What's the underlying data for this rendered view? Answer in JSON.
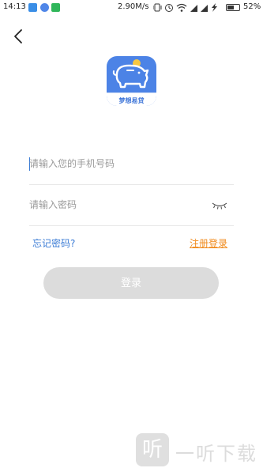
{
  "status_bar": {
    "time": "14:13",
    "network_speed": "2.90M/s",
    "battery": "52%",
    "icons": [
      "usb-icon",
      "app-notification-icon",
      "wechat-icon",
      "vibrate-icon",
      "alarm-icon",
      "wifi-icon",
      "signal-icon",
      "signal-icon",
      "charging-icon",
      "battery-icon"
    ]
  },
  "nav": {
    "back_icon": "back-arrow-icon"
  },
  "app": {
    "name": "梦想易贷",
    "brand_color": "#4c83e6"
  },
  "form": {
    "phone_placeholder": "请输入您的手机号码",
    "password_placeholder": "请输入密码",
    "password_toggle_icon": "eye-closed-icon"
  },
  "links": {
    "forgot_password": "忘记密码?",
    "register": "注册登录"
  },
  "login_button": "登录",
  "watermark": {
    "glyph": "听",
    "text": "一听下载"
  },
  "colors": {
    "link_blue": "#3a7bd5",
    "register_orange": "#f08a1c",
    "button_disabled": "#dcdcdc"
  }
}
